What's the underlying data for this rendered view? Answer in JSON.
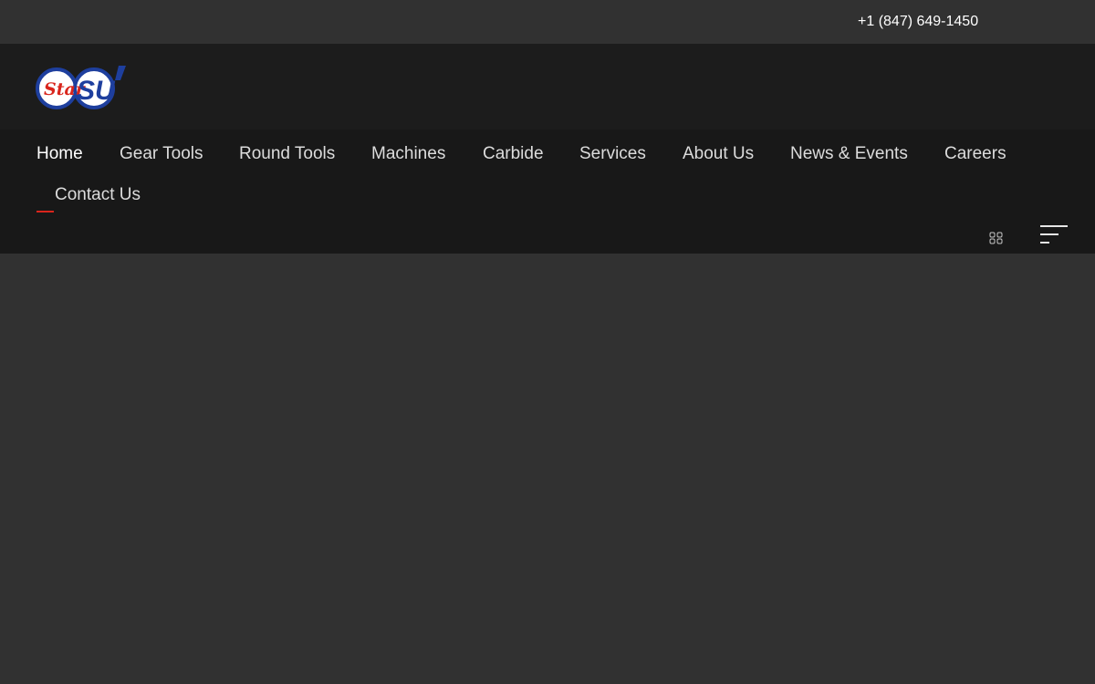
{
  "topbar": {
    "phone": "+1 (847) 649-1450"
  },
  "header": {
    "logo": {
      "icon": "star-su-logo",
      "brand_colors": [
        "#d9251c",
        "#1e3f9e",
        "#ffffff"
      ]
    }
  },
  "nav": {
    "items": [
      {
        "label": "Home",
        "active": true
      },
      {
        "label": "Gear Tools"
      },
      {
        "label": "Round Tools"
      },
      {
        "label": "Machines"
      },
      {
        "label": "Carbide"
      },
      {
        "label": "Services"
      },
      {
        "label": "About Us"
      },
      {
        "label": "News & Events"
      },
      {
        "label": "Careers"
      },
      {
        "label": "Contact Us"
      }
    ],
    "active_color": "#d9251c"
  },
  "icons": {
    "grid": "grid-icon",
    "menu": "hamburger-menu-icon"
  }
}
